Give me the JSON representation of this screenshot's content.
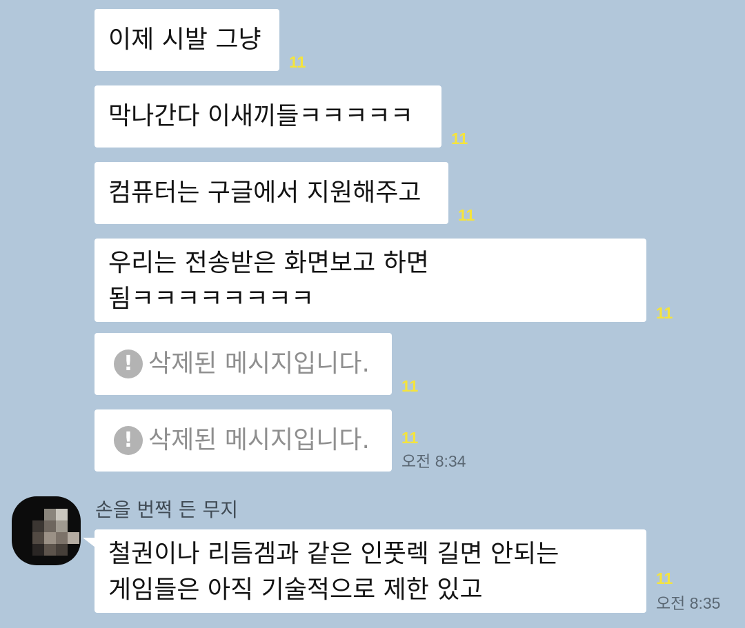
{
  "messages": [
    {
      "text": "이제 시발 그냥",
      "unread": "11"
    },
    {
      "text": "막나간다 이새끼들ㅋㅋㅋㅋㅋ",
      "unread": "11"
    },
    {
      "text": "컴퓨터는 구글에서 지원해주고",
      "unread": "11"
    },
    {
      "line1": "우리는 전송받은 화면보고 하면",
      "line2": "됨ㅋㅋㅋㅋㅋㅋㅋㅋ",
      "unread": "11"
    },
    {
      "text": "삭제된 메시지입니다.",
      "icon": "warning-icon",
      "unread": "11"
    },
    {
      "text": "삭제된 메시지입니다.",
      "icon": "warning-icon",
      "unread": "11",
      "time": "오전 8:34"
    }
  ],
  "incoming": {
    "sender": "손을 번쩍 든 무지",
    "avatar_icon": "pixelated-profile-avatar",
    "line1": "철권이나 리듬겜과 같은 인풋렉 길면 안되는",
    "line2": "게임들은 아직 기술적으로 제한 있고",
    "unread": "11",
    "time": "오전 8:35"
  },
  "colors": {
    "background": "#b2c7da",
    "bubble": "#ffffff",
    "unread": "#f5e43c",
    "deleted_text": "#8f8f8f",
    "time": "#5a6773"
  }
}
